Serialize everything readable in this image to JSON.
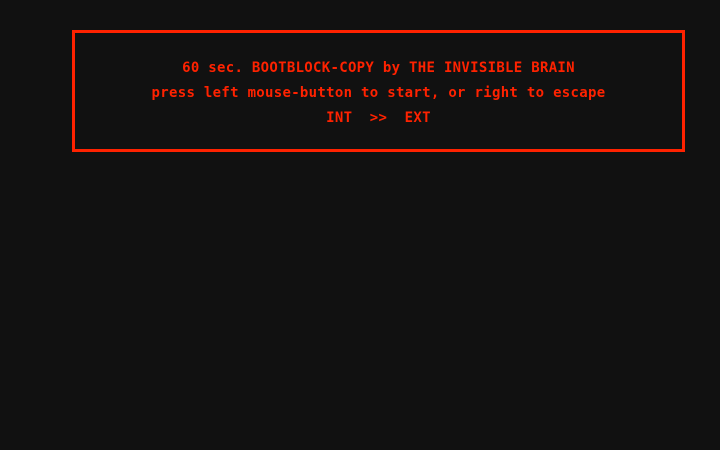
{
  "colors": {
    "background": "#111111",
    "accent": "#ff2200"
  },
  "dialog": {
    "title": "60 sec. BOOTBLOCK-COPY by THE INVISIBLE BRAIN",
    "instruction": "press left mouse-button to start, or right to escape",
    "direction": "INT  >>  EXT"
  }
}
